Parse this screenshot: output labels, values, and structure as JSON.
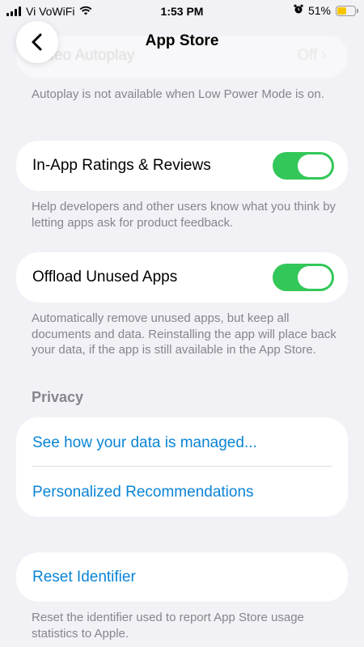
{
  "status_bar": {
    "carrier": "Vi VoWiFi",
    "time": "1:53 PM",
    "battery": "51%",
    "battery_level": 0.51
  },
  "nav": {
    "title": "App Store",
    "back_icon": "chevron-left-icon"
  },
  "video_autoplay": {
    "label": "Video Autoplay",
    "value": "Off",
    "footnote": "Autoplay is not available when Low Power Mode is on."
  },
  "ratings": {
    "label": "In-App Ratings & Reviews",
    "enabled": true,
    "footnote": "Help developers and other users know what you think by letting apps ask for product feedback."
  },
  "offload": {
    "label": "Offload Unused Apps",
    "enabled": true,
    "footnote": "Automatically remove unused apps, but keep all documents and data. Reinstalling the app will place back your data, if the app is still available in the App Store."
  },
  "privacy": {
    "header": "Privacy",
    "link1": "See how your data is managed...",
    "link2": "Personalized Recommendations"
  },
  "reset": {
    "label": "Reset Identifier",
    "footnote": "Reset the identifier used to report App Store usage statistics to Apple."
  },
  "colors": {
    "toggle_on": "#33c759",
    "link": "#0a84d6",
    "background": "#f2f1f6"
  }
}
